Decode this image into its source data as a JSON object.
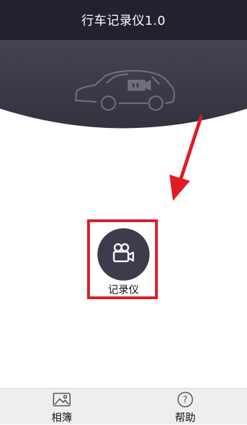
{
  "app": {
    "title": "行车记录仪1.0"
  },
  "main": {
    "recorder_button": {
      "label": "记录仪",
      "icon": "video-camera-icon"
    }
  },
  "bottom_nav": {
    "tabs": [
      {
        "label": "相簿",
        "icon": "image-icon"
      },
      {
        "label": "帮助",
        "icon": "help-circle-icon"
      }
    ]
  },
  "colors": {
    "header_bg": "#22222e",
    "arc_bg": "#3c3c4c",
    "annotation_red": "#e11b22",
    "tabbar_bg": "#eeeeee"
  }
}
